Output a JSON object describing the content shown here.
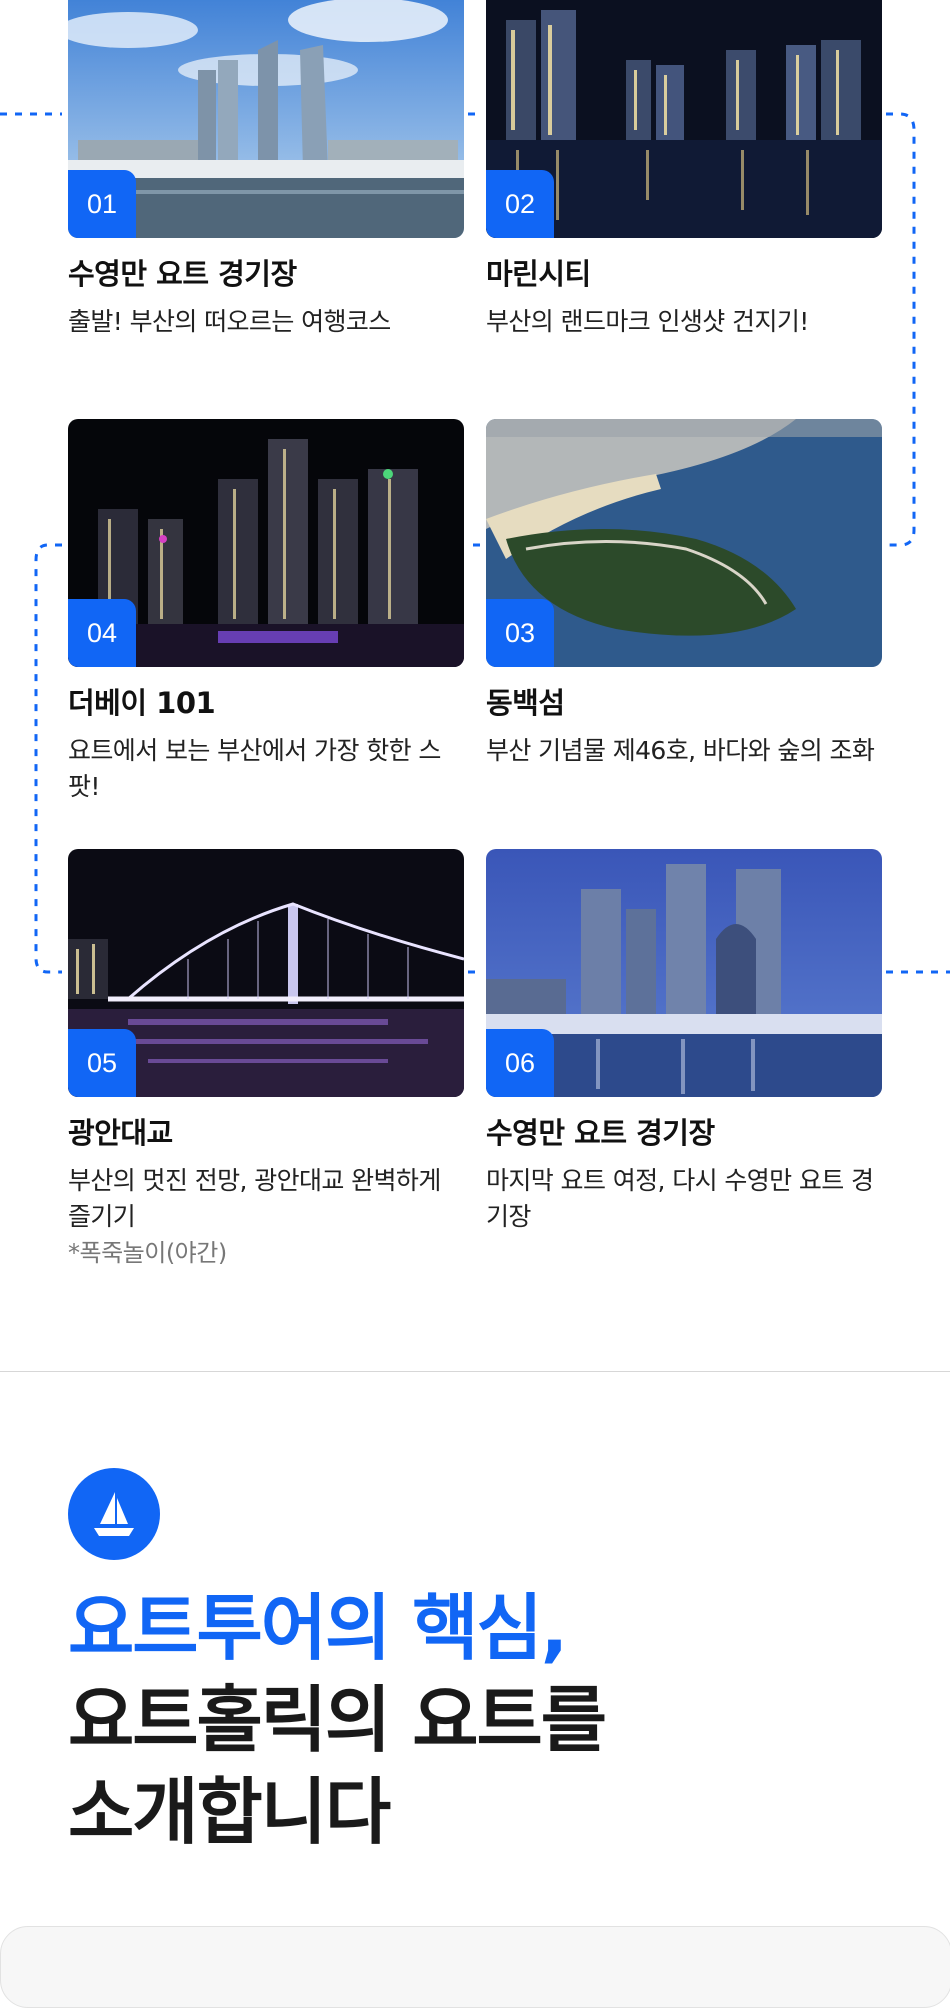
{
  "stops": [
    {
      "number": "01",
      "name": "수영만 요트 경기장",
      "desc": "출발! 부산의 떠오르는 여행코스",
      "note": ""
    },
    {
      "number": "02",
      "name": "마린시티",
      "desc": "부산의 랜드마크 인생샷 건지기!",
      "note": ""
    },
    {
      "number": "03",
      "name": "동백섬",
      "desc": "부산 기념물 제46호, 바다와 숲의 조화",
      "note": ""
    },
    {
      "number": "04",
      "name": "더베이 101",
      "desc": "요트에서 보는 부산에서 가장 핫한 스팟!",
      "note": ""
    },
    {
      "number": "05",
      "name": "광안대교",
      "desc": "부산의 멋진 전망, 광안대교 완벽하게 즐기기",
      "note": "*폭죽놀이(야간)"
    },
    {
      "number": "06",
      "name": "수영만 요트 경기장",
      "desc": "마지막 요트 여정, 다시 수영만 요트 경기장",
      "note": ""
    }
  ],
  "intro": {
    "icon": "sailboat-icon",
    "headline_line1": "요트투어의 핵심,",
    "headline_line2": "요트홀릭의 요트를",
    "headline_line3": "소개합니다"
  },
  "colors": {
    "accent": "#1166f5",
    "route_line": "#1166f5",
    "text": "#111111"
  }
}
